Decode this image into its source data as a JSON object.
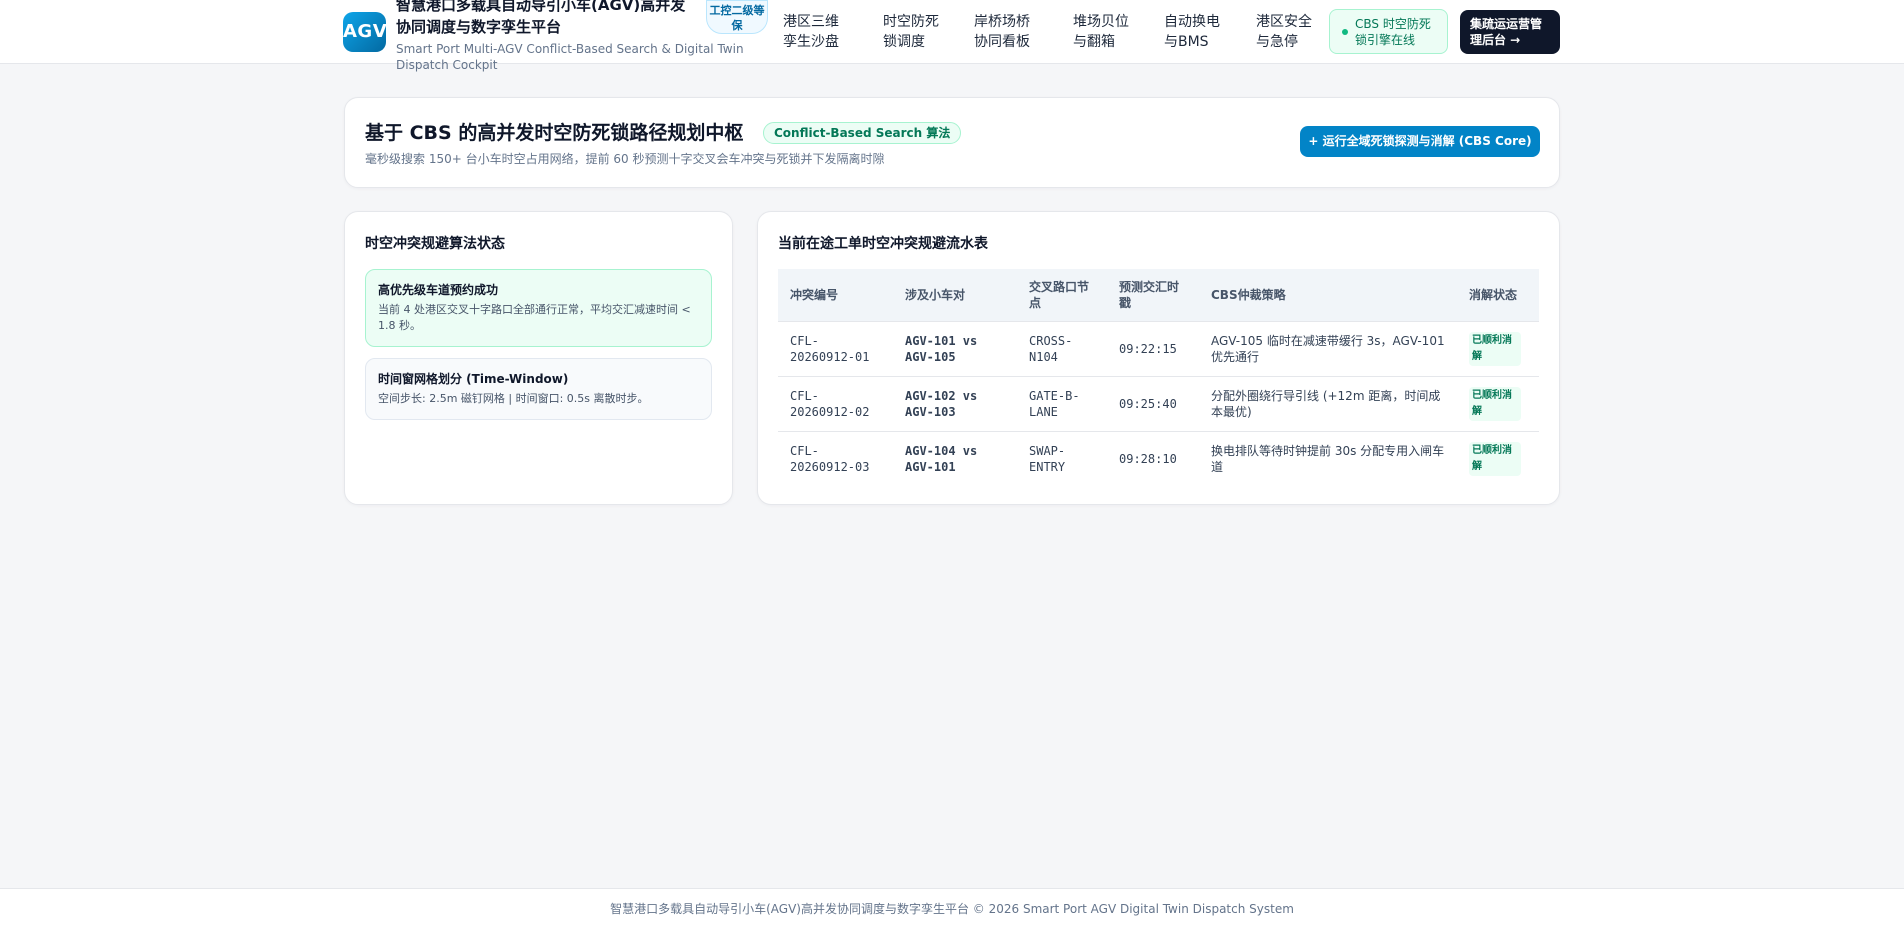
{
  "header": {
    "logo": "AGV",
    "title": "智慧港口多载具自动导引小车(AGV)高并发协同调度与数字孪生平台",
    "subtitle": "Smart Port Multi-AGV Conflict-Based Search & Digital Twin Dispatch Cockpit",
    "level_badge": "工控二级等保",
    "nav": [
      "港区三维孪生沙盘",
      "时空防死锁调度",
      "岸桥场桥协同看板",
      "堆场贝位与翻箱",
      "自动换电与BMS",
      "港区安全与急停"
    ],
    "status_pill": "CBS 时空防死锁引擎在线",
    "admin_button": "集疏运运营管理后台 →"
  },
  "hero": {
    "title": "基于 CBS 的高并发时空防死锁路径规划中枢",
    "badge": "Conflict-Based Search 算法",
    "description": "毫秒级搜索 150+ 台小车时空占用网络，提前 60 秒预测十字交叉会车冲突与死锁并下发隔离时隙",
    "run_button": "+ 运行全域死锁探测与消解 (CBS Core)"
  },
  "algo_status": {
    "title": "时空冲突规避算法状态",
    "items": [
      {
        "title": "高优先级车道预约成功",
        "desc": "当前 4 处港区交叉十字路口全部通行正常，平均交汇减速时间 < 1.8 秒。"
      },
      {
        "title": "时间窗网格划分 (Time-Window)",
        "desc": "空间步长: 2.5m 磁钉网格 | 时间窗口: 0.5s 离散时步。"
      }
    ]
  },
  "conflict_table": {
    "title": "当前在途工单时空冲突规避流水表",
    "columns": [
      "冲突编号",
      "涉及小车对",
      "交叉路口节点",
      "预测交汇时戳",
      "CBS仲裁策略",
      "消解状态"
    ],
    "rows": [
      {
        "id": "CFL-20260912-01",
        "pair": "AGV-101 vs AGV-105",
        "node": "CROSS-N104",
        "time": "09:22:15",
        "strategy": "AGV-105 临时在减速带缓行 3s，AGV-101 优先通行",
        "status": "已顺利消解"
      },
      {
        "id": "CFL-20260912-02",
        "pair": "AGV-102 vs AGV-103",
        "node": "GATE-B-LANE",
        "time": "09:25:40",
        "strategy": "分配外圈绕行导引线 (+12m 距离，时间成本最优)",
        "status": "已顺利消解"
      },
      {
        "id": "CFL-20260912-03",
        "pair": "AGV-104 vs AGV-101",
        "node": "SWAP-ENTRY",
        "time": "09:28:10",
        "strategy": "换电排队等待时钟提前 30s 分配专用入闸车道",
        "status": "已顺利消解"
      }
    ]
  },
  "footer": {
    "text": "智慧港口多载具自动导引小车(AGV)高并发协同调度与数字孪生平台 © 2026 Smart Port AGV Digital Twin Dispatch System"
  }
}
